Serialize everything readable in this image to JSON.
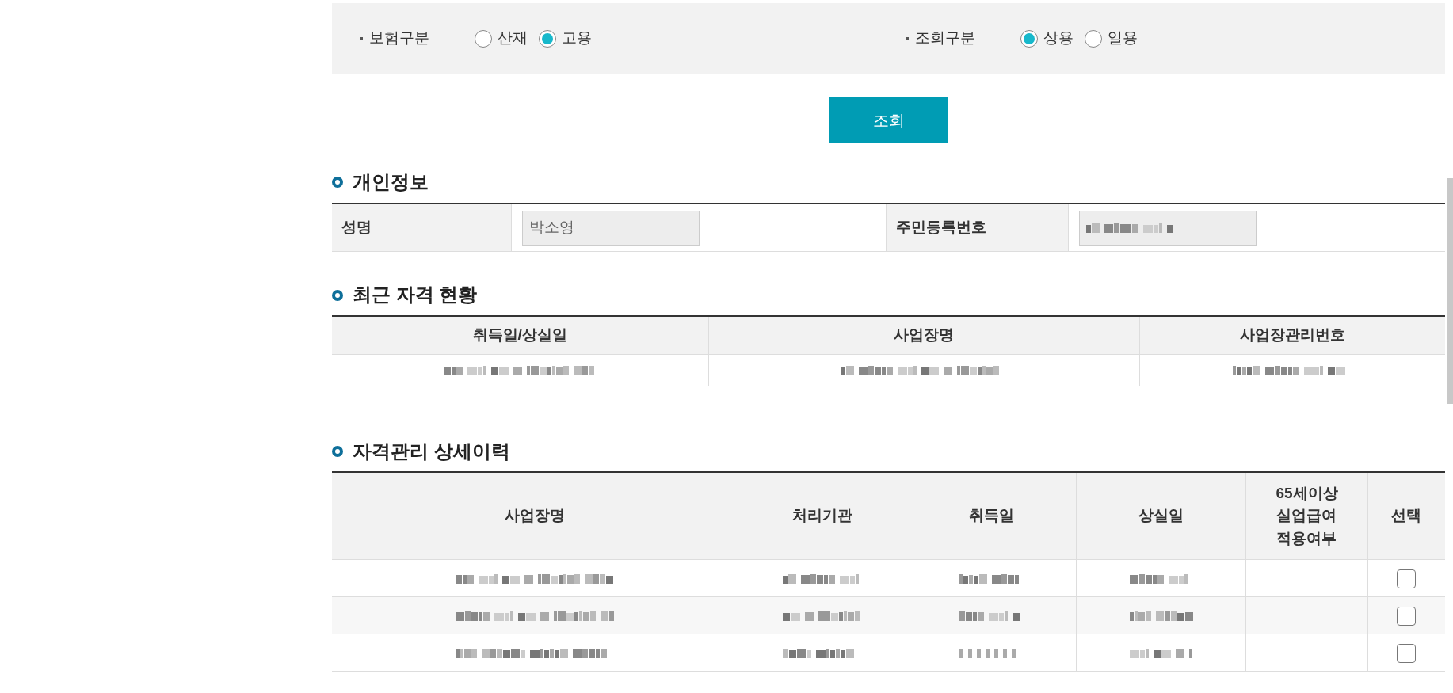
{
  "filters": [
    {
      "label": "보험구분",
      "options": [
        {
          "label": "산재",
          "selected": false
        },
        {
          "label": "고용",
          "selected": true
        }
      ]
    },
    {
      "label": "조회구분",
      "options": [
        {
          "label": "상용",
          "selected": true
        },
        {
          "label": "일용",
          "selected": false
        }
      ]
    }
  ],
  "search_button": "조회",
  "personal_info": {
    "title": "개인정보",
    "fields": [
      {
        "label": "성명",
        "value": "박소영",
        "blurred": false
      },
      {
        "label": "주민등록번호",
        "blurred": true
      }
    ]
  },
  "recent_status": {
    "title": "최근 자격 현황",
    "columns": [
      "취득일/상실일",
      "사업장명",
      "사업장관리번호"
    ],
    "rows": [
      {
        "cells": [
          {
            "blurred": true
          },
          {
            "blurred": true
          },
          {
            "blurred": true
          }
        ]
      }
    ]
  },
  "history": {
    "title": "자격관리 상세이력",
    "columns": [
      "사업장명",
      "처리기관",
      "취득일",
      "상실일",
      "65세이상\n실업급여\n적용여부",
      "선택"
    ],
    "rows": [
      {
        "cells": [
          {
            "blurred": true
          },
          {
            "blurred": true
          },
          {
            "blurred": true
          },
          {
            "blurred": true
          },
          {
            "blurred": false
          }
        ],
        "checked": false
      },
      {
        "cells": [
          {
            "blurred": true
          },
          {
            "blurred": true
          },
          {
            "blurred": true
          },
          {
            "blurred": true
          },
          {
            "blurred": false
          }
        ],
        "checked": false
      },
      {
        "cells": [
          {
            "blurred": true
          },
          {
            "blurred": true
          },
          {
            "blurred": true
          },
          {
            "blurred": true
          },
          {
            "blurred": false
          }
        ],
        "checked": false
      }
    ]
  }
}
